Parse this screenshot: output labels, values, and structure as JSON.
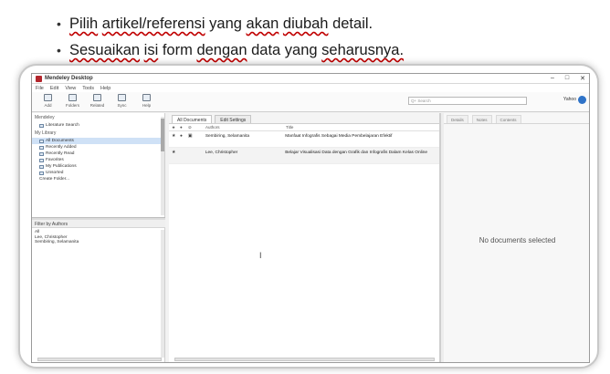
{
  "bullets": {
    "b1_w1": "Pilih",
    "b1_w2": "artikel/referensi",
    "b1_w3": "yang",
    "b1_w4": "akan",
    "b1_w5": "diubah",
    "b1_w6": "detail.",
    "b2_w1": "Sesuaikan",
    "b2_w2": "isi",
    "b2_w3": "form",
    "b2_w4": "dengan",
    "b2_w5": "data yang",
    "b2_w6": "seharusnya."
  },
  "app": {
    "title": "Mendeley Desktop",
    "window_controls": [
      "–",
      "□",
      "✕"
    ],
    "menu": [
      "File",
      "Edit",
      "View",
      "Tools",
      "Help"
    ],
    "toolbar": [
      {
        "label": "Add",
        "icon": "add-document-icon"
      },
      {
        "label": "Folders",
        "icon": "folder-icon"
      },
      {
        "label": "Related",
        "icon": "related-icon"
      },
      {
        "label": "Sync",
        "icon": "sync-icon"
      },
      {
        "label": "Help",
        "icon": "help-icon"
      }
    ],
    "search_placeholder": "Q+ Search",
    "user_name": "Yahoo"
  },
  "left": {
    "mendeley_header": "Mendeley",
    "literature_search": "Literature Search",
    "library_header": "My Library",
    "library_items": [
      "All Documents",
      "Recently Added",
      "Recently Read",
      "Favorites",
      "My Publications",
      "Unsorted",
      "Create Folder..."
    ],
    "filter_header": "Filter by Authors",
    "filter_items": [
      "All",
      "Lee, Christopher",
      "Sembiring, Selamanita"
    ]
  },
  "center": {
    "tabs": [
      "All Documents",
      "Edit Settings"
    ],
    "columns": {
      "authors": "Authors",
      "title": "Title"
    },
    "rows": [
      {
        "authors": "Sembiring, Selamanita",
        "title": "Manfaat Infografis Sebagai Media Pembelajaran Efektif"
      },
      {
        "authors": "Lee, Christopher",
        "title": "Belajar Visualisasi Data dengan Grafik dan Infografis Dalam Kelas Online"
      }
    ]
  },
  "right": {
    "tabs": [
      "Details",
      "Notes",
      "Contents"
    ],
    "empty_text": "No documents selected"
  },
  "colors": {
    "accent": "#2f73c8",
    "app_icon": "#b3262c",
    "selection": "#cfe1f6"
  }
}
